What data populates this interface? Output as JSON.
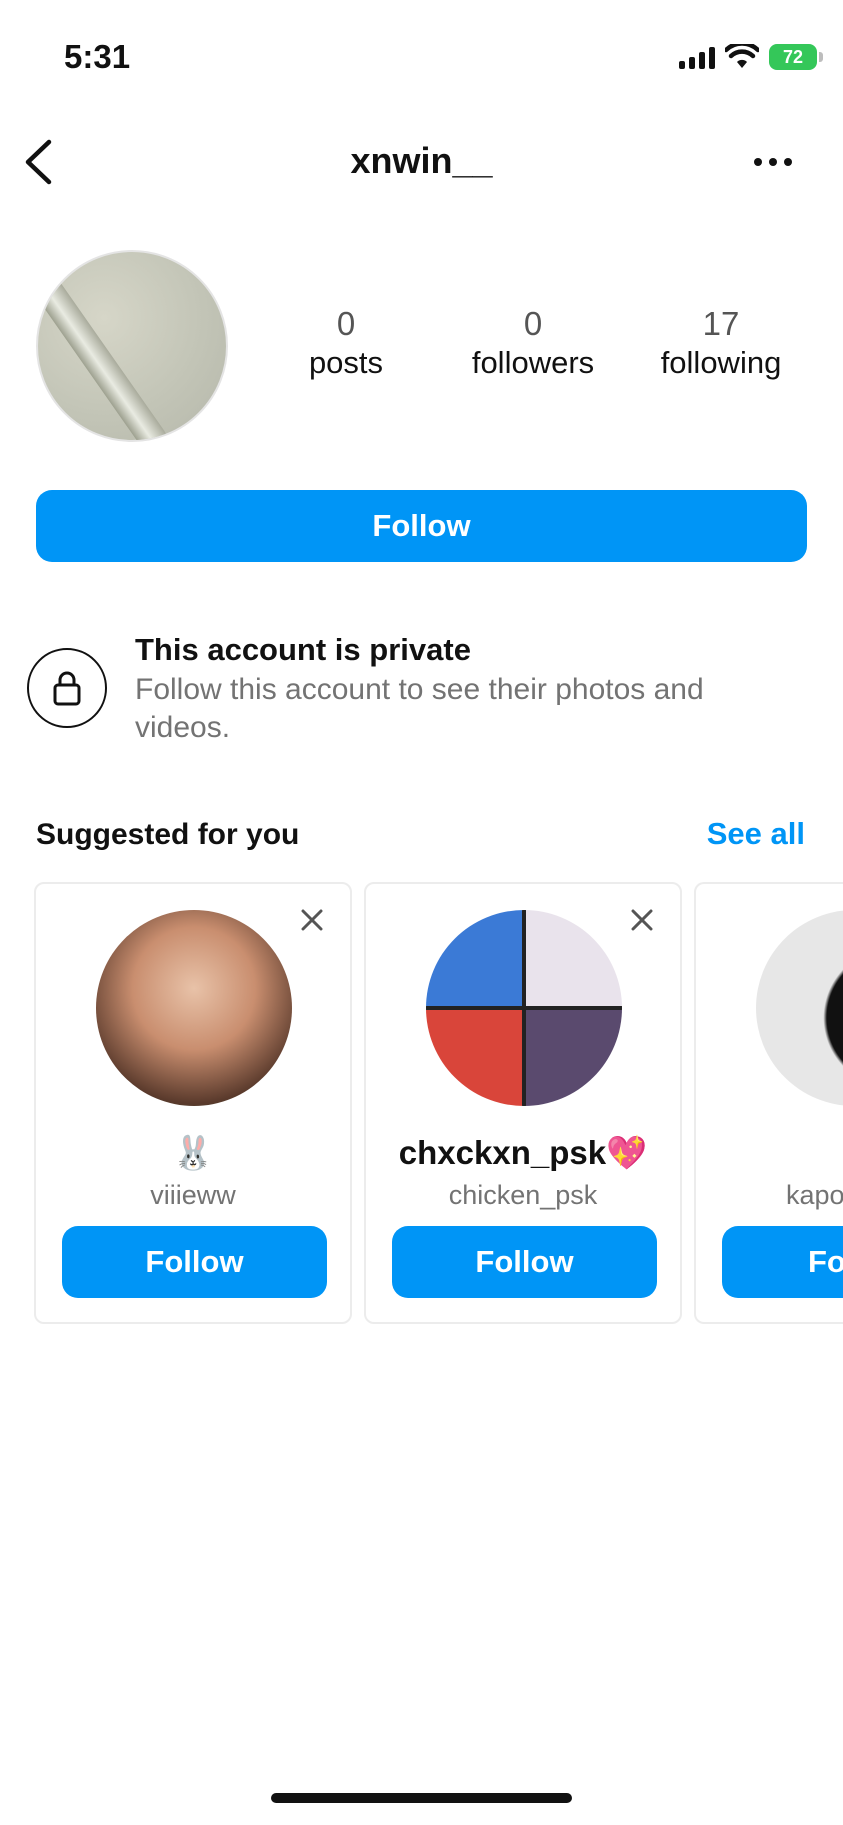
{
  "status_bar": {
    "time": "5:31",
    "battery": "72"
  },
  "header": {
    "username": "xnwin__"
  },
  "profile": {
    "stats": [
      {
        "value": "0",
        "label": "posts"
      },
      {
        "value": "0",
        "label": "followers"
      },
      {
        "value": "17",
        "label": "following"
      }
    ],
    "follow_label": "Follow"
  },
  "private_notice": {
    "title": "This account is private",
    "description": "Follow this account to see their photos and videos."
  },
  "suggestions": {
    "title": "Suggested for you",
    "see_all": "See all",
    "cards": [
      {
        "display_name": "🐰",
        "handle": "viiieww",
        "follow_label": "Follow"
      },
      {
        "display_name": "chxckxn_psk💖",
        "handle": "chicken_psk",
        "follow_label": "Follow"
      },
      {
        "display_name": "",
        "handle": "kapo",
        "follow_label": "Fo"
      }
    ]
  },
  "colors": {
    "accent": "#0095f6",
    "battery": "#34c759"
  }
}
